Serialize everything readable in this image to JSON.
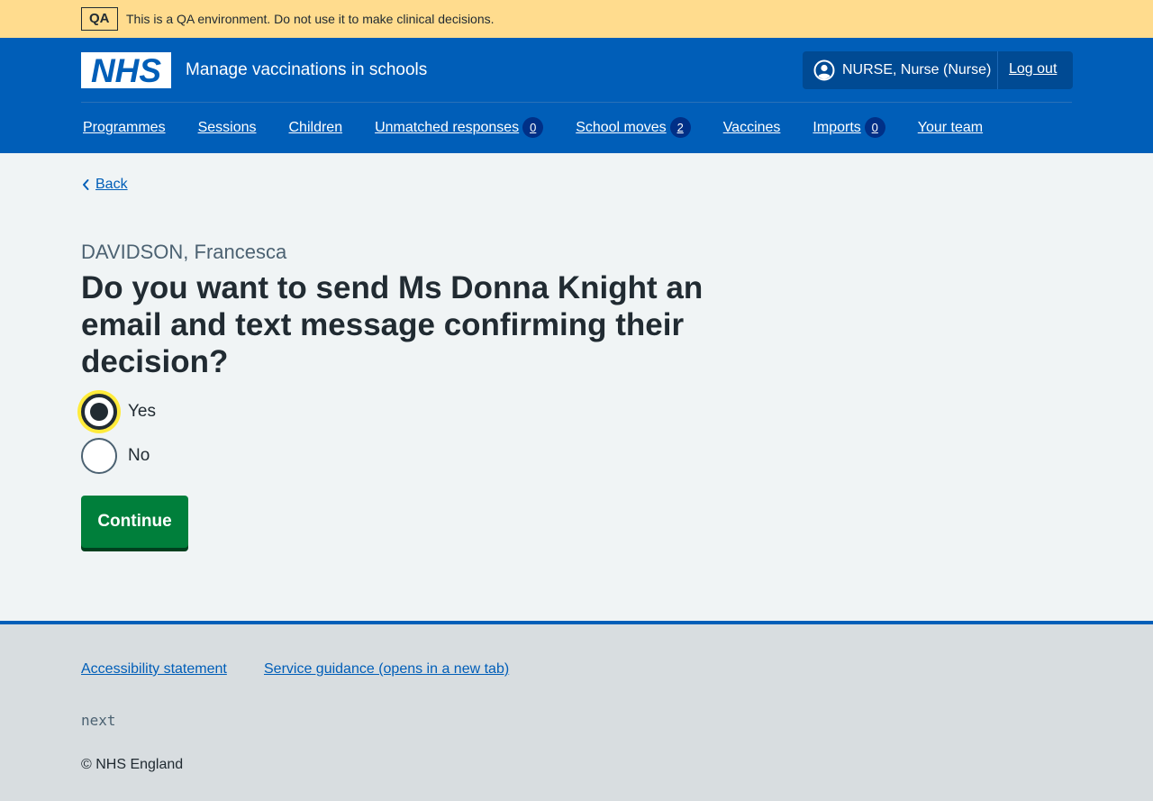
{
  "environment_banner": {
    "tag": "QA",
    "message": "This is a QA environment. Do not use it to make clinical decisions.",
    "color": "#ffdc8e"
  },
  "header": {
    "logo_text": "NHS",
    "service_name": "Manage vaccinations in schools",
    "account": {
      "user": "NURSE, Nurse (Nurse)",
      "icon": "user-circle-icon",
      "logout": "Log out"
    },
    "brand_color": "#005eb8"
  },
  "nav": {
    "items": [
      {
        "label": "Programmes"
      },
      {
        "label": "Sessions"
      },
      {
        "label": "Children"
      },
      {
        "label": "Unmatched responses",
        "count": "0"
      },
      {
        "label": "School moves",
        "count": "2"
      },
      {
        "label": "Vaccines"
      },
      {
        "label": "Imports",
        "count": "0"
      },
      {
        "label": "Your team"
      }
    ]
  },
  "main": {
    "back_link": "Back",
    "caption": "DAVIDSON, Francesca",
    "heading": "Do you want to send Ms Donna Knight an email and text message confirming their decision?",
    "options": [
      {
        "label": "Yes",
        "selected": true
      },
      {
        "label": "No",
        "selected": false
      }
    ],
    "continue_label": "Continue",
    "button_color": "#007f3b"
  },
  "footer": {
    "links": [
      "Accessibility statement",
      "Service guidance (opens in a new tab)"
    ],
    "version": "next",
    "copyright": "© NHS England"
  }
}
